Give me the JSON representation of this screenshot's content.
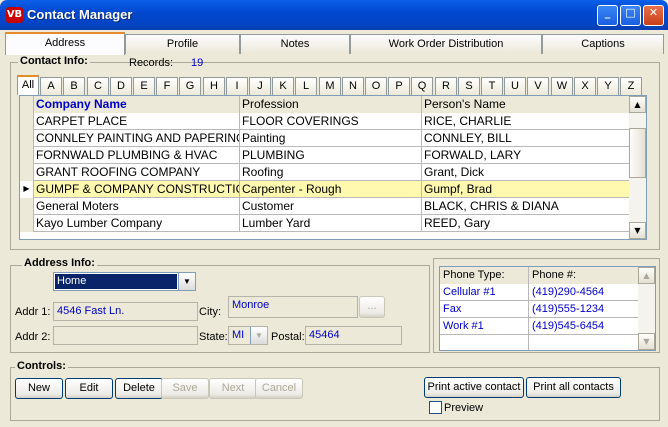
{
  "window": {
    "icon_text": "VB",
    "title": "Contact Manager",
    "minimize": "_",
    "maximize": "□",
    "close": "✕"
  },
  "tabs": [
    {
      "label": "Address",
      "active": true
    },
    {
      "label": "Profile"
    },
    {
      "label": "Notes"
    },
    {
      "label": "Work Order Distribution"
    },
    {
      "label": "Captions"
    }
  ],
  "contact_info": {
    "label": "Contact Info:",
    "records_label": "Records:",
    "records_count": "19",
    "letters": [
      "All",
      "A",
      "B",
      "C",
      "D",
      "E",
      "F",
      "G",
      "H",
      "I",
      "J",
      "K",
      "L",
      "M",
      "N",
      "O",
      "P",
      "Q",
      "R",
      "S",
      "T",
      "U",
      "V",
      "W",
      "X",
      "Y",
      "Z"
    ],
    "columns": [
      "Company Name",
      "Profession",
      "Person's Name"
    ],
    "rows": [
      [
        "CARPET PLACE",
        "FLOOR COVERINGS",
        "RICE, CHARLIE"
      ],
      [
        "CONNLEY PAINTING AND PAPERING",
        "Painting",
        "CONNLEY, BILL"
      ],
      [
        "FORNWALD PLUMBING & HVAC",
        "PLUMBING",
        "FORWALD, LARY"
      ],
      [
        "GRANT ROOFING COMPANY",
        "Roofing",
        "Grant, Dick"
      ],
      [
        "GUMPF & COMPANY CONSTRUCTION",
        "Carpenter - Rough",
        "Gumpf, Brad"
      ],
      [
        "General Moters",
        "Customer",
        "BLACK, CHRIS & DIANA"
      ],
      [
        "Kayo Lumber Company",
        "Lumber Yard",
        "REED, Gary"
      ]
    ],
    "selected_row": 4
  },
  "address_info": {
    "label": "Address Info:",
    "type_value": "Home",
    "addr1_label": "Addr 1:",
    "addr1_value": "4546 Fast Ln.",
    "addr2_label": "Addr 2:",
    "addr2_value": "",
    "city_label": "City:",
    "city_value": "Monroe",
    "city_button": "...",
    "state_label": "State:",
    "state_value": "MI",
    "postal_label": "Postal:",
    "postal_value": "45464"
  },
  "phones": {
    "columns": [
      "Phone Type:",
      "Phone #:"
    ],
    "rows": [
      [
        "Cellular #1",
        "(419)290-4564"
      ],
      [
        "Fax",
        "(419)555-1234"
      ],
      [
        "Work #1",
        "(419)545-6454"
      ]
    ]
  },
  "controls": {
    "label": "Controls:",
    "new": "New",
    "edit": "Edit",
    "delete": "Delete",
    "save": "Save",
    "next": "Next",
    "cancel": "Cancel",
    "print_active": "Print active contact",
    "print_all": "Print all contacts",
    "preview": "Preview"
  }
}
